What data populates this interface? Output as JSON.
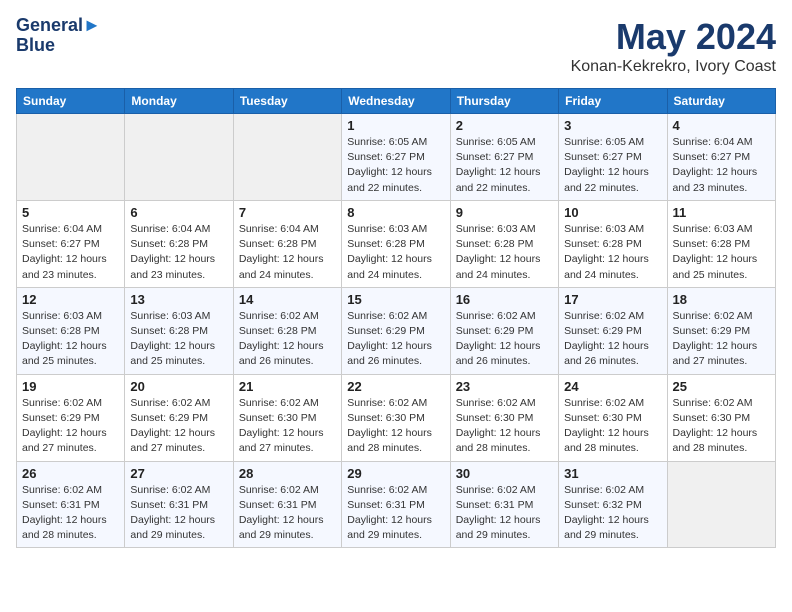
{
  "logo": {
    "line1": "General",
    "line2": "Blue"
  },
  "title": "May 2024",
  "location": "Konan-Kekrekro, Ivory Coast",
  "days_of_week": [
    "Sunday",
    "Monday",
    "Tuesday",
    "Wednesday",
    "Thursday",
    "Friday",
    "Saturday"
  ],
  "weeks": [
    [
      {
        "day": "",
        "sunrise": "",
        "sunset": "",
        "daylight": ""
      },
      {
        "day": "",
        "sunrise": "",
        "sunset": "",
        "daylight": ""
      },
      {
        "day": "",
        "sunrise": "",
        "sunset": "",
        "daylight": ""
      },
      {
        "day": "1",
        "sunrise": "Sunrise: 6:05 AM",
        "sunset": "Sunset: 6:27 PM",
        "daylight": "Daylight: 12 hours and 22 minutes."
      },
      {
        "day": "2",
        "sunrise": "Sunrise: 6:05 AM",
        "sunset": "Sunset: 6:27 PM",
        "daylight": "Daylight: 12 hours and 22 minutes."
      },
      {
        "day": "3",
        "sunrise": "Sunrise: 6:05 AM",
        "sunset": "Sunset: 6:27 PM",
        "daylight": "Daylight: 12 hours and 22 minutes."
      },
      {
        "day": "4",
        "sunrise": "Sunrise: 6:04 AM",
        "sunset": "Sunset: 6:27 PM",
        "daylight": "Daylight: 12 hours and 23 minutes."
      }
    ],
    [
      {
        "day": "5",
        "sunrise": "Sunrise: 6:04 AM",
        "sunset": "Sunset: 6:27 PM",
        "daylight": "Daylight: 12 hours and 23 minutes."
      },
      {
        "day": "6",
        "sunrise": "Sunrise: 6:04 AM",
        "sunset": "Sunset: 6:28 PM",
        "daylight": "Daylight: 12 hours and 23 minutes."
      },
      {
        "day": "7",
        "sunrise": "Sunrise: 6:04 AM",
        "sunset": "Sunset: 6:28 PM",
        "daylight": "Daylight: 12 hours and 24 minutes."
      },
      {
        "day": "8",
        "sunrise": "Sunrise: 6:03 AM",
        "sunset": "Sunset: 6:28 PM",
        "daylight": "Daylight: 12 hours and 24 minutes."
      },
      {
        "day": "9",
        "sunrise": "Sunrise: 6:03 AM",
        "sunset": "Sunset: 6:28 PM",
        "daylight": "Daylight: 12 hours and 24 minutes."
      },
      {
        "day": "10",
        "sunrise": "Sunrise: 6:03 AM",
        "sunset": "Sunset: 6:28 PM",
        "daylight": "Daylight: 12 hours and 24 minutes."
      },
      {
        "day": "11",
        "sunrise": "Sunrise: 6:03 AM",
        "sunset": "Sunset: 6:28 PM",
        "daylight": "Daylight: 12 hours and 25 minutes."
      }
    ],
    [
      {
        "day": "12",
        "sunrise": "Sunrise: 6:03 AM",
        "sunset": "Sunset: 6:28 PM",
        "daylight": "Daylight: 12 hours and 25 minutes."
      },
      {
        "day": "13",
        "sunrise": "Sunrise: 6:03 AM",
        "sunset": "Sunset: 6:28 PM",
        "daylight": "Daylight: 12 hours and 25 minutes."
      },
      {
        "day": "14",
        "sunrise": "Sunrise: 6:02 AM",
        "sunset": "Sunset: 6:28 PM",
        "daylight": "Daylight: 12 hours and 26 minutes."
      },
      {
        "day": "15",
        "sunrise": "Sunrise: 6:02 AM",
        "sunset": "Sunset: 6:29 PM",
        "daylight": "Daylight: 12 hours and 26 minutes."
      },
      {
        "day": "16",
        "sunrise": "Sunrise: 6:02 AM",
        "sunset": "Sunset: 6:29 PM",
        "daylight": "Daylight: 12 hours and 26 minutes."
      },
      {
        "day": "17",
        "sunrise": "Sunrise: 6:02 AM",
        "sunset": "Sunset: 6:29 PM",
        "daylight": "Daylight: 12 hours and 26 minutes."
      },
      {
        "day": "18",
        "sunrise": "Sunrise: 6:02 AM",
        "sunset": "Sunset: 6:29 PM",
        "daylight": "Daylight: 12 hours and 27 minutes."
      }
    ],
    [
      {
        "day": "19",
        "sunrise": "Sunrise: 6:02 AM",
        "sunset": "Sunset: 6:29 PM",
        "daylight": "Daylight: 12 hours and 27 minutes."
      },
      {
        "day": "20",
        "sunrise": "Sunrise: 6:02 AM",
        "sunset": "Sunset: 6:29 PM",
        "daylight": "Daylight: 12 hours and 27 minutes."
      },
      {
        "day": "21",
        "sunrise": "Sunrise: 6:02 AM",
        "sunset": "Sunset: 6:30 PM",
        "daylight": "Daylight: 12 hours and 27 minutes."
      },
      {
        "day": "22",
        "sunrise": "Sunrise: 6:02 AM",
        "sunset": "Sunset: 6:30 PM",
        "daylight": "Daylight: 12 hours and 28 minutes."
      },
      {
        "day": "23",
        "sunrise": "Sunrise: 6:02 AM",
        "sunset": "Sunset: 6:30 PM",
        "daylight": "Daylight: 12 hours and 28 minutes."
      },
      {
        "day": "24",
        "sunrise": "Sunrise: 6:02 AM",
        "sunset": "Sunset: 6:30 PM",
        "daylight": "Daylight: 12 hours and 28 minutes."
      },
      {
        "day": "25",
        "sunrise": "Sunrise: 6:02 AM",
        "sunset": "Sunset: 6:30 PM",
        "daylight": "Daylight: 12 hours and 28 minutes."
      }
    ],
    [
      {
        "day": "26",
        "sunrise": "Sunrise: 6:02 AM",
        "sunset": "Sunset: 6:31 PM",
        "daylight": "Daylight: 12 hours and 28 minutes."
      },
      {
        "day": "27",
        "sunrise": "Sunrise: 6:02 AM",
        "sunset": "Sunset: 6:31 PM",
        "daylight": "Daylight: 12 hours and 29 minutes."
      },
      {
        "day": "28",
        "sunrise": "Sunrise: 6:02 AM",
        "sunset": "Sunset: 6:31 PM",
        "daylight": "Daylight: 12 hours and 29 minutes."
      },
      {
        "day": "29",
        "sunrise": "Sunrise: 6:02 AM",
        "sunset": "Sunset: 6:31 PM",
        "daylight": "Daylight: 12 hours and 29 minutes."
      },
      {
        "day": "30",
        "sunrise": "Sunrise: 6:02 AM",
        "sunset": "Sunset: 6:31 PM",
        "daylight": "Daylight: 12 hours and 29 minutes."
      },
      {
        "day": "31",
        "sunrise": "Sunrise: 6:02 AM",
        "sunset": "Sunset: 6:32 PM",
        "daylight": "Daylight: 12 hours and 29 minutes."
      },
      {
        "day": "",
        "sunrise": "",
        "sunset": "",
        "daylight": ""
      }
    ]
  ]
}
